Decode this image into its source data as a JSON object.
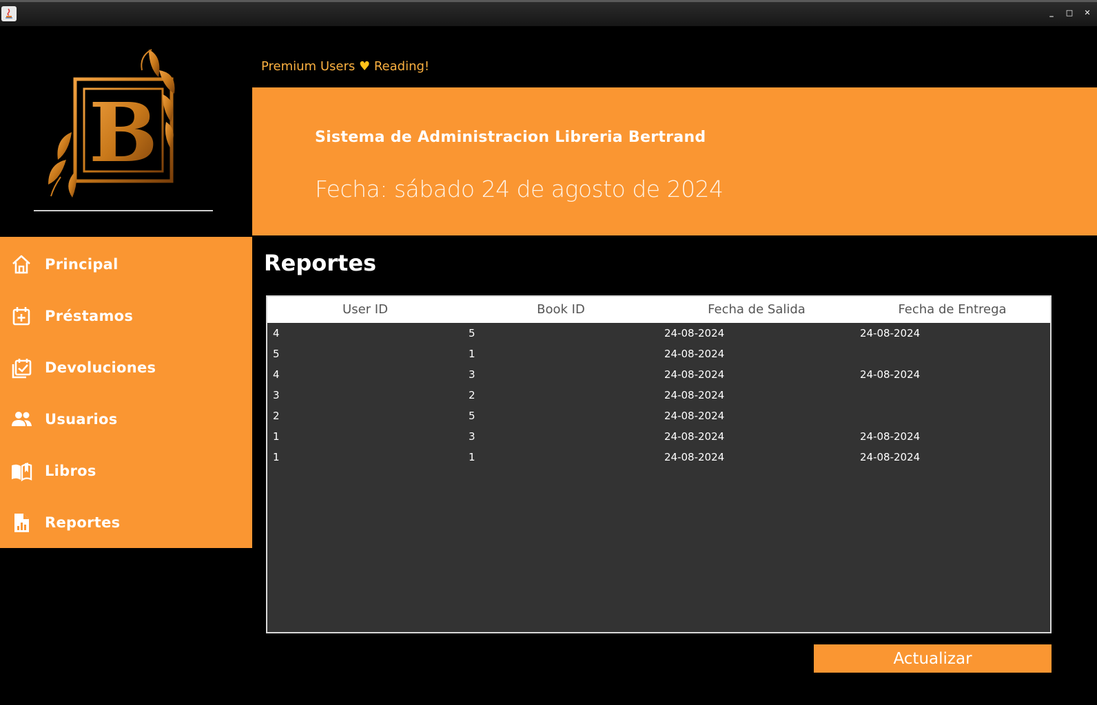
{
  "window": {
    "buttons": [
      "minimize",
      "maximize",
      "close"
    ]
  },
  "header": {
    "tagline_left": "Premium Users",
    "tagline_right": "Reading!",
    "title": "Sistema de Administracion Libreria Bertrand",
    "date": "Fecha: sábado 24 de agosto de 2024"
  },
  "logo": {
    "letter": "B"
  },
  "sidebar": {
    "items": [
      {
        "label": "Principal",
        "icon": "home-icon"
      },
      {
        "label": "Préstamos",
        "icon": "calendar-plus-icon"
      },
      {
        "label": "Devoluciones",
        "icon": "calendar-check-icon"
      },
      {
        "label": "Usuarios",
        "icon": "users-icon"
      },
      {
        "label": "Libros",
        "icon": "book-icon"
      },
      {
        "label": "Reportes",
        "icon": "report-icon"
      }
    ]
  },
  "main": {
    "section_title": "Reportes",
    "table": {
      "columns": [
        "User ID",
        "Book ID",
        "Fecha de Salida",
        "Fecha de Entrega"
      ],
      "rows": [
        [
          "4",
          "5",
          "24-08-2024",
          "24-08-2024"
        ],
        [
          "5",
          "1",
          "24-08-2024",
          ""
        ],
        [
          "4",
          "3",
          "24-08-2024",
          "24-08-2024"
        ],
        [
          "3",
          "2",
          "24-08-2024",
          ""
        ],
        [
          "2",
          "5",
          "24-08-2024",
          ""
        ],
        [
          "1",
          "3",
          "24-08-2024",
          "24-08-2024"
        ],
        [
          "1",
          "1",
          "24-08-2024",
          "24-08-2024"
        ]
      ]
    },
    "refresh_label": "Actualizar"
  },
  "colors": {
    "accent": "#fa9632",
    "background": "#000000",
    "table_body": "#333333",
    "gold": "#c8781a"
  }
}
